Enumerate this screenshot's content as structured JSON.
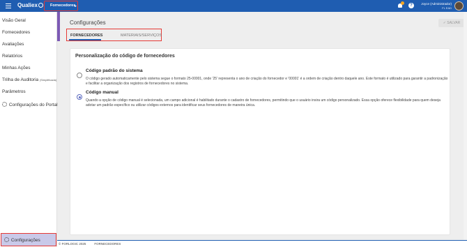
{
  "topbar": {
    "logo": "Qualiex",
    "module": "Fornecedores",
    "user_name": "Joyce (Administrador)",
    "user_sub": "FL EAD",
    "help_glyph": "?"
  },
  "sidebar": {
    "items": [
      {
        "label": "Visão Geral"
      },
      {
        "label": "Fornecedores"
      },
      {
        "label": "Avaliações"
      },
      {
        "label": "Relatórios"
      },
      {
        "label": "Minhas Ações"
      },
      {
        "label": "Trilha de Auditoria",
        "suffix": "(Simplificada)"
      },
      {
        "label": "Parâmetros"
      },
      {
        "label": "Configurações do Portal"
      }
    ],
    "bottom_item": "Configurações"
  },
  "page": {
    "title": "Configurações",
    "save_label": "SALVAR",
    "tabs": [
      {
        "label": "FORNECEDORES",
        "active": true
      },
      {
        "label": "MATERIAIS/SERVIÇOS",
        "active": false
      }
    ]
  },
  "section": {
    "title": "Personalização do código de fornecedores",
    "options": [
      {
        "title": "Código padrão do sistema",
        "description": "O código gerado automaticamente pelo sistema segue o formato 25-00001, onde '25' representa o ano de criação do fornecedor e '00001' é a ordem de criação dentro daquele ano. Este formato é utilizado para garantir a padronização e facilitar a organização dos registros de fornecedores no sistema.",
        "selected": false
      },
      {
        "title": "Código manual",
        "description": "Quando a opção de código manual é selecionada, um campo adicional é habilitado durante o cadastro de fornecedores, permitindo que o usuário insira um código personalizado. Essa opção oferece flexibilidade para quem deseja adotar um padrão específico ou utilizar códigos externos para identificar seus fornecedores de maneira única.",
        "selected": true
      }
    ]
  },
  "footer": {
    "copyright": "© FORLOGIC 2025",
    "module": "FORNECEDORES"
  },
  "colors": {
    "topbar": "#1f5db1",
    "accent": "#7d5ab5",
    "highlight_border": "#e53935",
    "radio_selected": "#5c6bc0",
    "notification_badge": "#f5a623"
  }
}
